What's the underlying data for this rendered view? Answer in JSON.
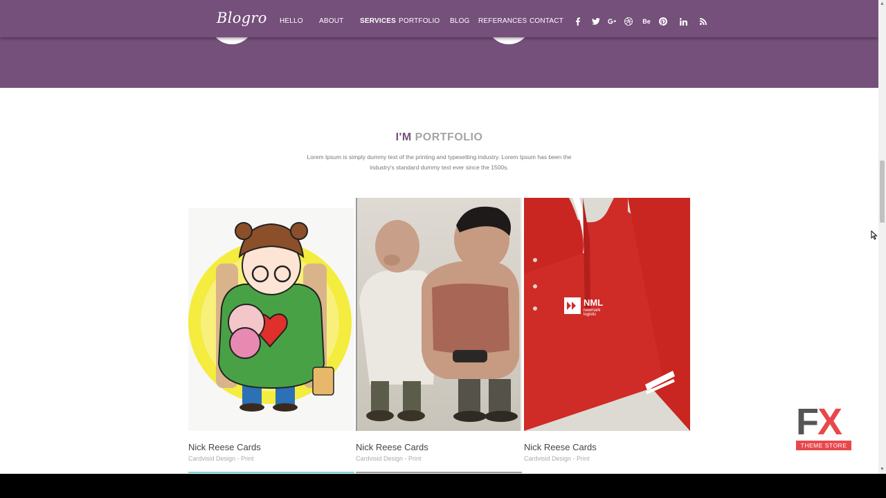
{
  "brand": {
    "logo": "Blogro"
  },
  "nav": {
    "items": [
      {
        "label": "HELLO"
      },
      {
        "label": "ABOUT"
      },
      {
        "label": "SERVICES"
      },
      {
        "label": "PORTFOLIO"
      },
      {
        "label": "BLOG"
      },
      {
        "label": "REFERANCES"
      },
      {
        "label": "CONTACT"
      }
    ],
    "active": "SERVICES",
    "social": [
      "facebook-icon",
      "twitter-icon",
      "google-plus-icon",
      "dribbble-icon",
      "behance-icon",
      "pinterest-icon",
      "linkedin-icon",
      "rss-icon"
    ]
  },
  "portfolio": {
    "title_prefix": "I'M",
    "title_suffix": "PORTFOLIO",
    "description": "Lorem Ipsum is simply dummy text of the printing and typesetting industry. Lorem Ipsum has been the industry's standard dummy text ever since the 1500s.",
    "cards": [
      {
        "title": "Nick Reese Cards",
        "subtitle": "Cardvisid Design - Print",
        "image": "bear-hat-character-illustration"
      },
      {
        "title": "Nick Reese Cards",
        "subtitle": "Cardvisid Design - Print",
        "image": "two-tough-guys-3d-characters"
      },
      {
        "title": "Nick Reese Cards",
        "subtitle": "Cardvisid Design - Print",
        "image": "red-polo-shirt-mockup",
        "shirt_logo": {
          "mark": "NML",
          "line1": "newmark",
          "line2": "logistic"
        }
      }
    ]
  },
  "watermark": {
    "letters": "FX",
    "text": "THEME STORE"
  },
  "colors": {
    "brand_purple": "#75507b",
    "accent_red": "#e8484b",
    "title_grey": "#a4a4a4"
  }
}
